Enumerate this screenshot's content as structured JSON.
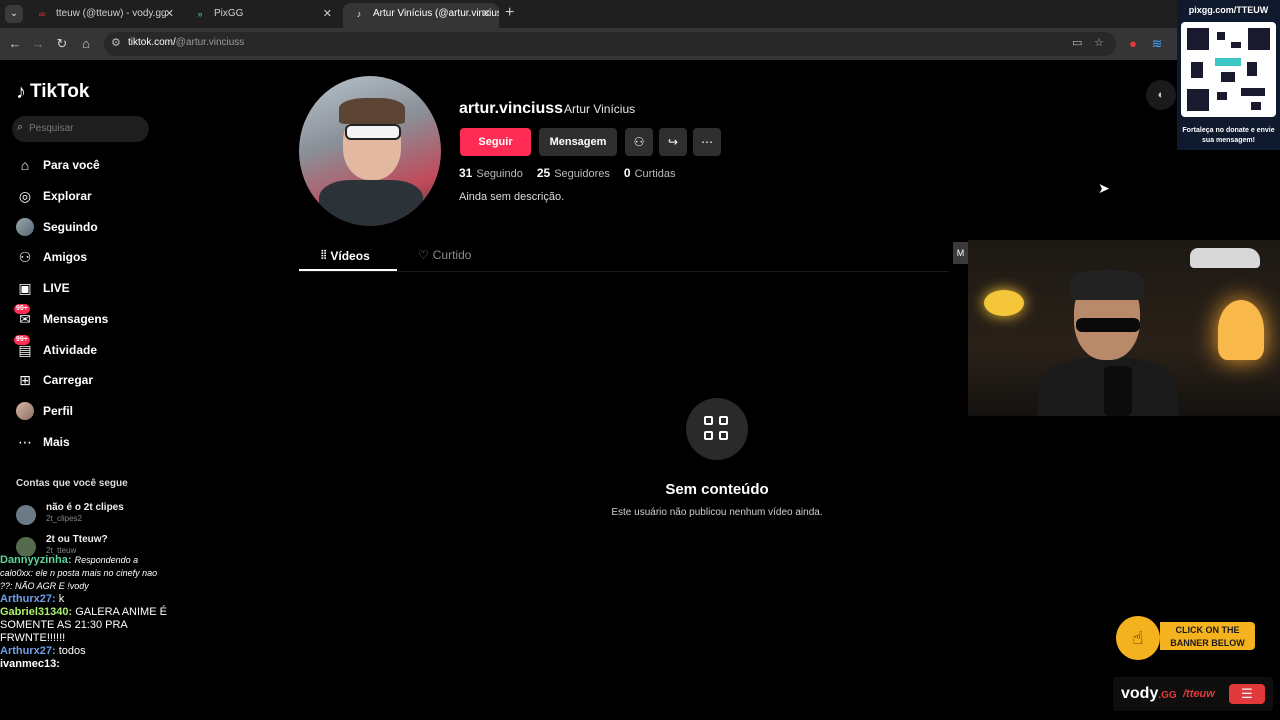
{
  "browser": {
    "tabs": [
      {
        "label": "tteuw (@tteuw) - vody.gg",
        "icon_color": "#e23a3a",
        "active": false
      },
      {
        "label": "PixGG",
        "icon_color": "#3ec7c7",
        "active": false
      },
      {
        "label": "Artur Vinícius (@artur.vinciuss)",
        "icon_color": "#ffffff",
        "active": true
      }
    ],
    "address": {
      "host": "tiktok.com/",
      "path": "@artur.vinciuss"
    }
  },
  "sidebar": {
    "logo": "TikTok",
    "search_placeholder": "Pesquisar",
    "items": [
      {
        "label": "Para você",
        "icon": "home-icon"
      },
      {
        "label": "Explorar",
        "icon": "compass-icon"
      },
      {
        "label": "Seguindo",
        "icon": "following-avatar-icon"
      },
      {
        "label": "Amigos",
        "icon": "friends-icon"
      },
      {
        "label": "LIVE",
        "icon": "live-icon"
      },
      {
        "label": "Mensagens",
        "icon": "messages-icon",
        "badge": "99+"
      },
      {
        "label": "Atividade",
        "icon": "activity-icon",
        "badge": "99+"
      },
      {
        "label": "Carregar",
        "icon": "upload-icon"
      },
      {
        "label": "Perfil",
        "icon": "profile-avatar-icon"
      },
      {
        "label": "Mais",
        "icon": "more-icon"
      }
    ],
    "following_title": "Contas que você segue",
    "following": [
      {
        "name": "não é o 2t clipes",
        "handle": "2t_clipes2"
      },
      {
        "name": "2t ou Tteuw?",
        "handle": "2t_tteuw"
      }
    ]
  },
  "profile": {
    "username": "artur.vinciuss",
    "display_name": "Artur Vinícius",
    "follow_label": "Seguir",
    "message_label": "Mensagem",
    "stats": [
      {
        "value": "31",
        "label": "Seguindo"
      },
      {
        "value": "25",
        "label": "Seguidores"
      },
      {
        "value": "0",
        "label": "Curtidas"
      }
    ],
    "bio": "Ainda sem descrição.",
    "tabs": [
      {
        "label": "Vídeos",
        "active": true
      },
      {
        "label": "Curtido",
        "active": false
      }
    ],
    "empty_title": "Sem conteúdo",
    "empty_subtitle": "Este usuário não publicou nenhum vídeo ainda."
  },
  "overlay": {
    "qr_url": "pixgg.com/TTEUW",
    "qr_caption": "Fortaleça no donate e envie sua mensagem!",
    "chat": [
      {
        "user": "Dannyyzinha:",
        "user_color": "#5dd39e",
        "text": "Respondendo a calo0xx: ele n posta mais no cinefy nao ??: NÃO AGR E !vody",
        "italic_prefix": true
      },
      {
        "user": "Arthurx27:",
        "user_color": "#6f9fe8",
        "text": "k"
      },
      {
        "user": "Gabriel31340:",
        "user_color": "#a9f06b",
        "text": "GALERA ANIME É SOMENTE AS 21:30 PRA FRWNTE!!!!!!"
      },
      {
        "user": "Arthurx27:",
        "user_color": "#6f9fe8",
        "text": "todos"
      },
      {
        "user": "ivanmec13:",
        "user_color": "#ffffff",
        "text": ""
      }
    ],
    "banner_text": "CLICK ON THE BANNER BELOW",
    "vody_brand": "vody",
    "vody_tld": ".GG",
    "vody_user": "/tteuw",
    "cam_tag": "M"
  },
  "colors": {
    "accent": "#fe2c55",
    "background": "#000000"
  }
}
